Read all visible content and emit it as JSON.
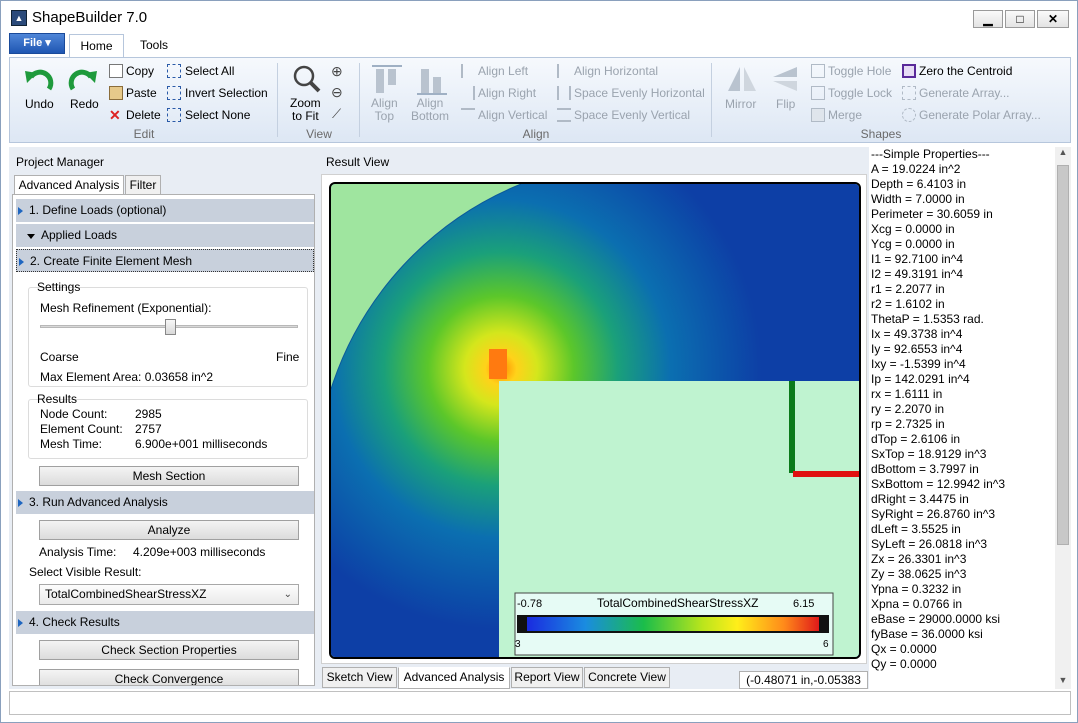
{
  "app": {
    "title": "ShapeBuilder 7.0"
  },
  "ribbon": {
    "file_label": "File",
    "tabs": [
      "Home",
      "Tools"
    ],
    "edit": {
      "undo": "Undo",
      "redo": "Redo",
      "copy": "Copy",
      "paste": "Paste",
      "delete": "Delete",
      "select_all": "Select All",
      "invert_selection": "Invert Selection",
      "select_none": "Select None",
      "group": "Edit"
    },
    "view": {
      "zoom_to_fit": "Zoom\nto Fit",
      "zoom_to_fit_1": "Zoom",
      "zoom_to_fit_2": "to Fit",
      "group": "View"
    },
    "align": {
      "align_top_1": "Align",
      "align_top_2": "Top",
      "align_bottom_1": "Align",
      "align_bottom_2": "Bottom",
      "align_left": "Align Left",
      "align_right": "Align Right",
      "align_vertical": "Align Vertical",
      "align_horizontal": "Align Horizontal",
      "space_h": "Space Evenly Horizontal",
      "space_v": "Space Evenly Vertical",
      "group": "Align"
    },
    "shapes": {
      "mirror": "Mirror",
      "flip": "Flip",
      "toggle_hole": "Toggle Hole",
      "toggle_lock": "Toggle Lock",
      "merge": "Merge",
      "zero_centroid": "Zero the Centroid",
      "generate_array": "Generate Array...",
      "generate_polar": "Generate Polar Array...",
      "group": "Shapes"
    }
  },
  "project_manager": {
    "title": "Project Manager",
    "tabs": [
      "Advanced Analysis",
      "Filter"
    ],
    "step1": "1. Define Loads (optional)",
    "applied_loads": "Applied Loads",
    "step2": "2. Create Finite Element Mesh",
    "settings": {
      "title": "Settings",
      "mesh_refinement": "Mesh Refinement (Exponential):",
      "coarse": "Coarse",
      "fine": "Fine",
      "max_area": "Max Element Area: 0.03658 in^2",
      "slider_level": 0.5
    },
    "results": {
      "title": "Results",
      "node_count_label": "Node Count:",
      "node_count": "2985",
      "element_count_label": "Element Count:",
      "element_count": "2757",
      "mesh_time_label": "Mesh Time:",
      "mesh_time": "6.900e+001 milliseconds"
    },
    "mesh_section": "Mesh Section",
    "step3": "3. Run Advanced Analysis",
    "analyze": "Analyze",
    "analysis_time_label": "Analysis Time:",
    "analysis_time": "4.209e+003 milliseconds",
    "select_visible": "Select Visible Result:",
    "visible_result": "TotalCombinedShearStressXZ",
    "step4": "4. Check Results",
    "check_section": "Check Section Properties",
    "check_convergence": "Check Convergence"
  },
  "result_view": {
    "title": "Result View",
    "legend": {
      "min": "-0.78",
      "name": "TotalCombinedShearStressXZ",
      "max": "6.15",
      "left_tick": "3",
      "right_tick": "6"
    },
    "tabs": [
      "Sketch View",
      "Advanced Analysis",
      "Report View",
      "Concrete View"
    ],
    "coords": "(-0.48071 in,-0.05383 in)"
  },
  "properties": [
    "---Simple Properties---",
    "A = 19.0224 in^2",
    "Depth = 6.4103 in",
    "Width = 7.0000 in",
    "Perimeter = 30.6059 in",
    "Xcg = 0.0000 in",
    "Ycg = 0.0000 in",
    "I1 = 92.7100 in^4",
    "I2 = 49.3191 in^4",
    "r1 = 2.2077 in",
    "r2 = 1.6102 in",
    "ThetaP = 1.5353 rad.",
    "Ix = 49.3738 in^4",
    "Iy = 92.6553 in^4",
    "Ixy = -1.5399 in^4",
    "Ip = 142.0291 in^4",
    "rx = 1.6111 in",
    "ry = 2.2070 in",
    "rp = 2.7325 in",
    "dTop = 2.6106 in",
    "SxTop = 18.9129 in^3",
    "dBottom = 3.7997 in",
    "SxBottom = 12.9942 in^3",
    "dRight = 3.4475 in",
    "SyRight = 26.8760 in^3",
    "dLeft = 3.5525 in",
    "SyLeft = 26.0818 in^3",
    "Zx = 26.3301 in^3",
    "Zy = 38.0625 in^3",
    "Ypna = 0.3232 in",
    "Xpna = 0.0766 in",
    "eBase = 29000.0000 ksi",
    "fyBase = 36.0000 ksi",
    "Qx = 0.0000",
    "Qy = 0.0000"
  ]
}
